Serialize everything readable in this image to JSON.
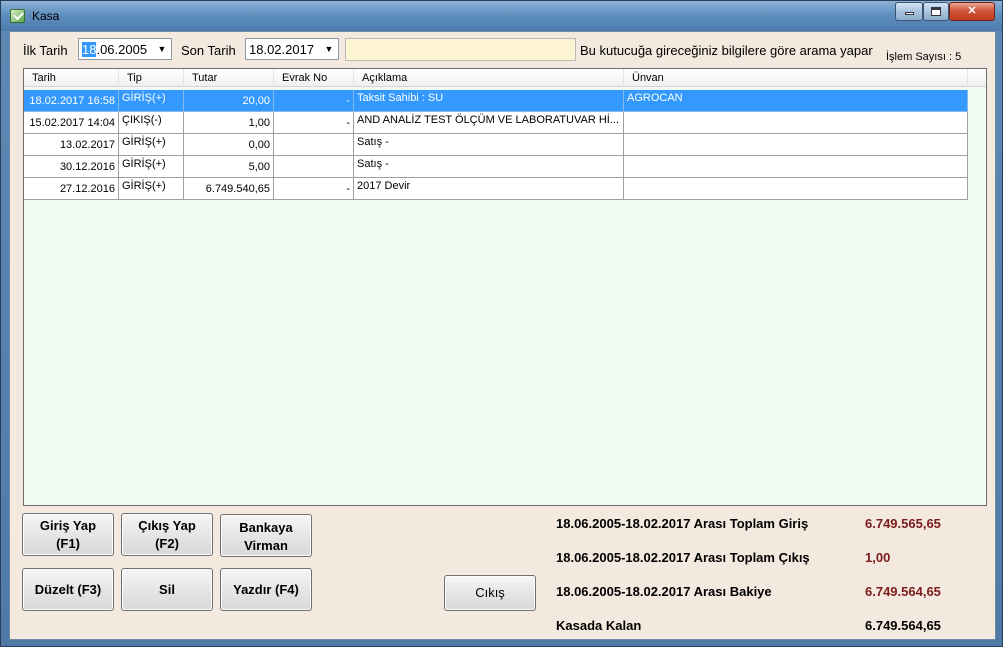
{
  "window": {
    "title": "Kasa",
    "colors": {
      "selection": "#3399ff",
      "client_bg": "#f4e9df",
      "grid_bg": "#f1fbf4",
      "search_bg": "#fdf5d2",
      "value_red": "#7a1c1c"
    }
  },
  "filter": {
    "start_label": "İlk Tarih",
    "start_date_selected": "18",
    "start_date_rest": ".06.2005",
    "end_label": "Son Tarih",
    "end_date": "18.02.2017",
    "search_value": "",
    "search_hint": "Bu kutucuğa gireceğiniz bilgilere göre arama yapar",
    "count_label": "İşlem Sayısı : 5"
  },
  "grid": {
    "columns": [
      "Tarih",
      "Tip",
      "Tutar",
      "Evrak No",
      "Açıklama",
      "Ünvan"
    ],
    "rows": [
      {
        "tarih": "18.02.2017 16:58",
        "tip": "GİRİŞ(+)",
        "tutar": "20,00",
        "evrak": "-",
        "aciklama": "Taksit Sahibi : SU",
        "unvan": "AGROCAN",
        "selected": true
      },
      {
        "tarih": "15.02.2017 14:04",
        "tip": "ÇIKIŞ(-)",
        "tutar": "1,00",
        "evrak": "-",
        "aciklama": "AND ANALİZ TEST ÖLÇÜM VE LABORATUVAR Hİ...",
        "unvan": "",
        "selected": false
      },
      {
        "tarih": "13.02.2017",
        "tip": "GİRİŞ(+)",
        "tutar": "0,00",
        "evrak": "",
        "aciklama": "Satış -",
        "unvan": "",
        "selected": false
      },
      {
        "tarih": "30.12.2016",
        "tip": "GİRİŞ(+)",
        "tutar": "5,00",
        "evrak": "",
        "aciklama": "Satış -",
        "unvan": "",
        "selected": false
      },
      {
        "tarih": "27.12.2016",
        "tip": "GİRİŞ(+)",
        "tutar": "6.749.540,65",
        "evrak": "-",
        "aciklama": "2017 Devir",
        "unvan": "",
        "selected": false
      }
    ]
  },
  "buttons": {
    "giris_line1": "Giriş Yap",
    "giris_line2": "(F1)",
    "cikis_line1": "Çıkış Yap",
    "cikis_line2": "(F2)",
    "virman_line1": "Bankaya",
    "virman_line2": "Virman",
    "duzelt": "Düzelt (F3)",
    "sil": "Sil",
    "yazdir": "Yazdır (F4)",
    "close": "Cıkış"
  },
  "summary": [
    {
      "label": "18.06.2005-18.02.2017 Arası Toplam Giriş",
      "value": "6.749.565,65"
    },
    {
      "label": "18.06.2005-18.02.2017 Arası Toplam Çıkış",
      "value": "1,00"
    },
    {
      "label": "18.06.2005-18.02.2017 Arası Bakiye",
      "value": "6.749.564,65"
    },
    {
      "label": "Kasada Kalan",
      "value": "6.749.564,65"
    }
  ]
}
